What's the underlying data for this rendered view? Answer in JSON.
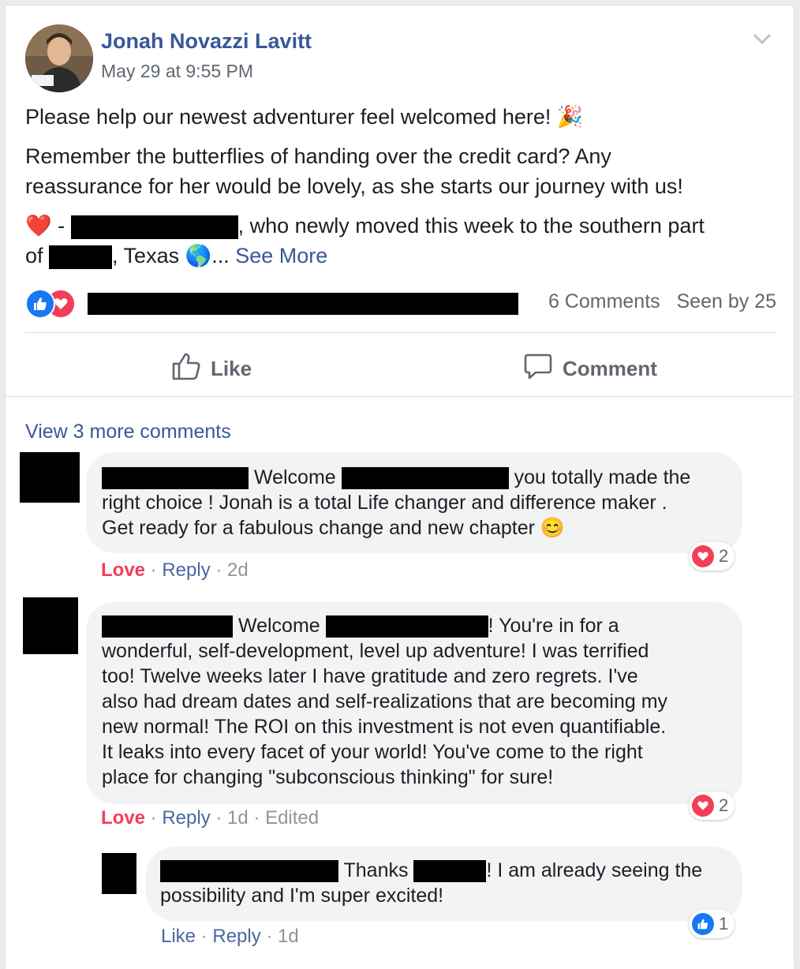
{
  "post": {
    "author": "Jonah Novazzi Lavitt",
    "timestamp": "May 29 at 9:55 PM",
    "line1": "Please help our newest adventurer feel welcomed here! ",
    "line1_emoji": "🎉",
    "line2": "Remember the butterflies of handing over the credit card? Any",
    "line3": "reassurance for her would be lovely, as she starts our journey with us!",
    "line4_prefix": "❤️ - ",
    "line4_suffix": ", who newly moved this week to the southern part",
    "line5_prefix": "of ",
    "line5_middle": ", Texas ",
    "line5_emoji": "🌎",
    "line5_ellipsis": "... ",
    "see_more": "See More"
  },
  "meta": {
    "comments": "6 Comments",
    "seen_by": "Seen by 25"
  },
  "actions": {
    "like": "Like",
    "comment": "Comment"
  },
  "comments": {
    "view_more": "View 3 more comments",
    "c1": {
      "l1a": "Welcome ",
      "l1b": " you totally made the",
      "l2": "right choice ! Jonah is a total Life changer and difference maker .",
      "l3": "Get ready for a fabulous change and new chapter 😊",
      "love": "Love",
      "reply": "Reply",
      "time": "2d",
      "count": "2"
    },
    "c2": {
      "l1a": "Welcome ",
      "l1b": "! You're in for a",
      "l2": "wonderful, self-development, level up adventure! I was terrified",
      "l3": "too! Twelve weeks later I have gratitude and zero regrets. I've",
      "l4": "also had dream dates and self-realizations that are becoming my",
      "l5": "new normal! The ROI on this investment is not even quantifiable.",
      "l6": "It leaks into every facet of your world! You've come to the right",
      "l7": "place for changing \"subconscious thinking\" for sure!",
      "love": "Love",
      "reply": "Reply",
      "time": "1d",
      "edited": "Edited",
      "count": "2"
    },
    "c3": {
      "l1a": "Thanks ",
      "l1b": "! I am already seeing the",
      "l2": "possibility and I'm super excited!",
      "like": "Like",
      "reply": "Reply",
      "time": "1d",
      "count": "1"
    },
    "sep": " · "
  },
  "colors": {
    "link": "#385898",
    "love": "#f33e58",
    "like_blue": "#1877f2",
    "bubble": "#f2f3f5"
  }
}
